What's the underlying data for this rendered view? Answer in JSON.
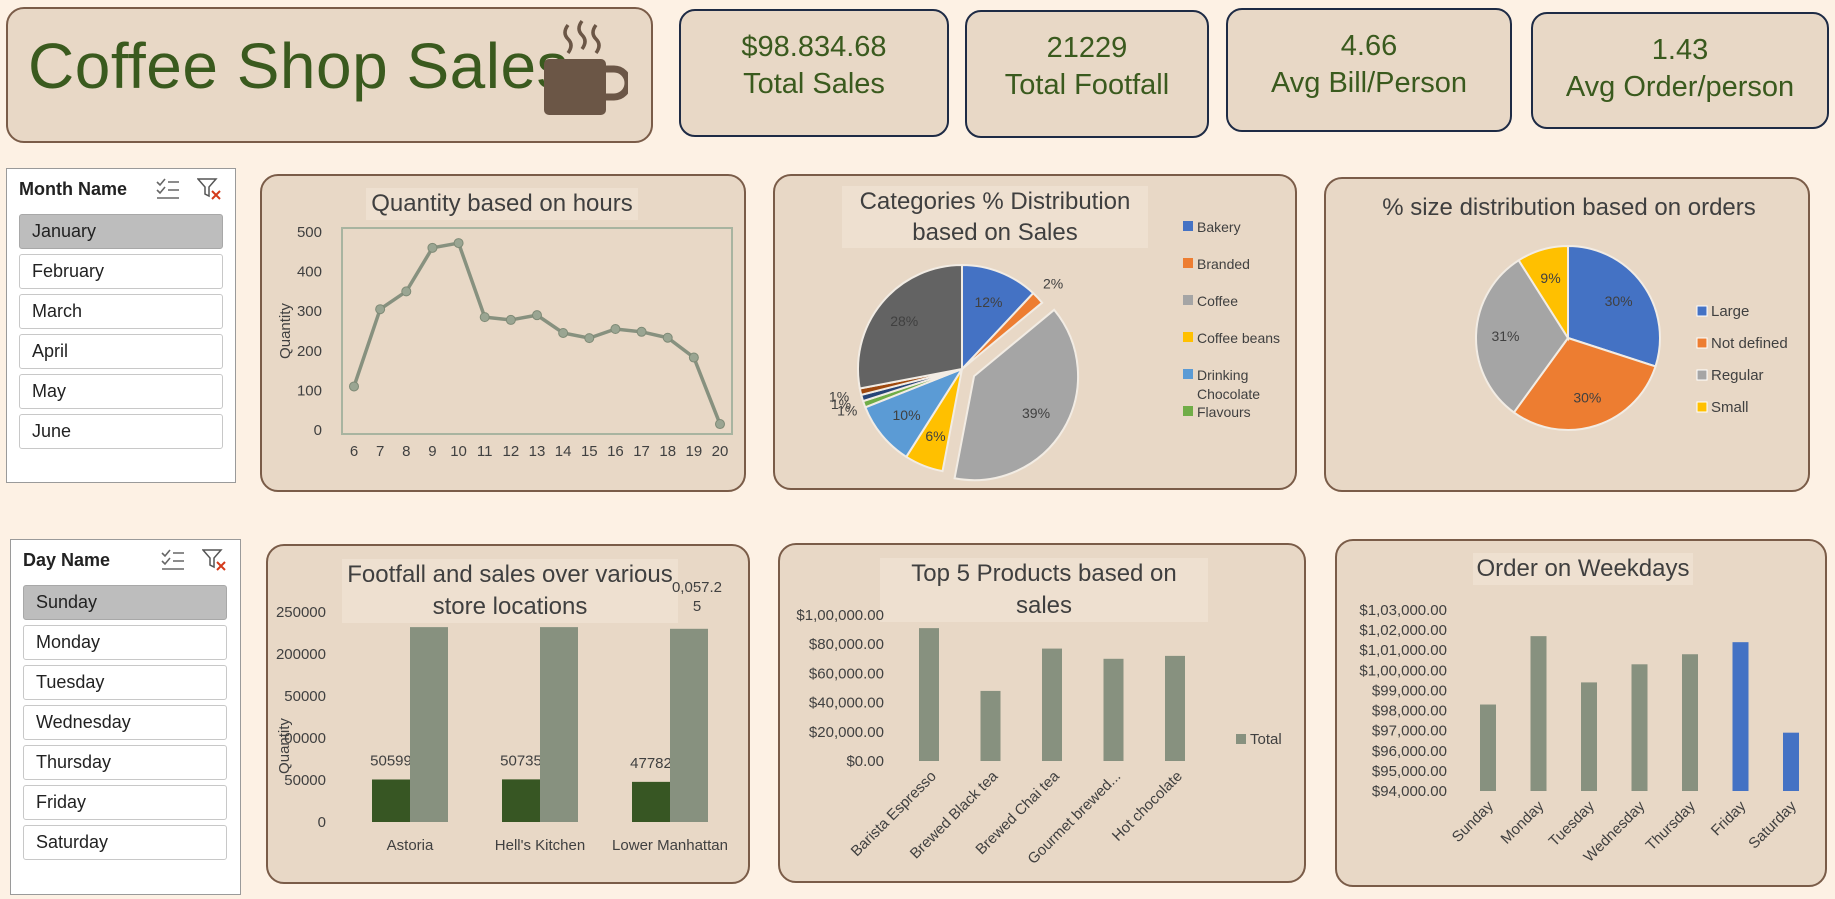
{
  "dashboard": {
    "title": "Coffee Shop Sales"
  },
  "kpis": [
    {
      "value": "$98.834.68",
      "label": "Total Sales"
    },
    {
      "value": "21229",
      "label": "Total Footfall"
    },
    {
      "value": "4.66",
      "label": "Avg Bill/Person"
    },
    {
      "value": "1.43",
      "label": "Avg Order/person"
    }
  ],
  "slicers": {
    "month": {
      "title": "Month Name",
      "items": [
        "January",
        "February",
        "March",
        "April",
        "May",
        "June"
      ],
      "selected": "January"
    },
    "day": {
      "title": "Day Name",
      "items": [
        "Sunday",
        "Monday",
        "Tuesday",
        "Wednesday",
        "Thursday",
        "Friday",
        "Saturday"
      ],
      "selected": "Sunday"
    }
  },
  "icons": [
    "coffee-cup-icon",
    "multi-select-icon",
    "clear-filter-icon"
  ],
  "colors": {
    "accent_green": "#3a5a1e",
    "series_gray": "#87917f",
    "highlight_blue": "#4472c4",
    "card_bg": "#e8d8c6",
    "page_bg": "#fdf1e4"
  },
  "chart_data": [
    {
      "id": "hours",
      "type": "line",
      "title": "Quantity based on hours",
      "ylabel": "Quantity",
      "x": [
        6,
        7,
        8,
        9,
        10,
        11,
        12,
        13,
        14,
        15,
        16,
        17,
        18,
        19,
        20
      ],
      "values": [
        110,
        305,
        350,
        460,
        472,
        285,
        278,
        290,
        245,
        232,
        255,
        248,
        233,
        183,
        15
      ],
      "ylim": [
        0,
        500
      ],
      "yticks": [
        0,
        100,
        200,
        300,
        400,
        500
      ],
      "color": "#87917f"
    },
    {
      "id": "categories",
      "type": "pie",
      "title": "Categories % Distribution based on Sales",
      "legend_position": "right",
      "slices": [
        {
          "name": "Bakery",
          "value": 12,
          "label": "12%",
          "color": "#4472c4"
        },
        {
          "name": "Branded",
          "value": 2,
          "label": "2%",
          "color": "#ed7d31"
        },
        {
          "name": "Coffee",
          "value": 39,
          "label": "39%",
          "color": "#a5a5a5"
        },
        {
          "name": "Coffee beans",
          "value": 6,
          "label": "6%",
          "color": "#ffc000"
        },
        {
          "name": "Drinking Chocolate",
          "value": 10,
          "label": "10%",
          "color": "#5b9bd5"
        },
        {
          "name": "Flavours",
          "value": 1,
          "label": "1%",
          "color": "#70ad47"
        },
        {
          "name": "",
          "value": 1,
          "label": "1%",
          "color": "#264478"
        },
        {
          "name": "",
          "value": 1,
          "label": "1%",
          "color": "#9e480e"
        },
        {
          "name": "",
          "value": 28,
          "label": "28%",
          "color": "#636363"
        }
      ]
    },
    {
      "id": "sizes",
      "type": "pie",
      "title": "% size distribution based on orders",
      "legend_position": "right",
      "slices": [
        {
          "name": "Large",
          "value": 30,
          "label": "30%",
          "color": "#4472c4"
        },
        {
          "name": "Not defined",
          "value": 30,
          "label": "30%",
          "color": "#ed7d31"
        },
        {
          "name": "Regular",
          "value": 31,
          "label": "31%",
          "color": "#a5a5a5"
        },
        {
          "name": "Small",
          "value": 9,
          "label": "9%",
          "color": "#ffc000"
        }
      ]
    },
    {
      "id": "locations",
      "type": "bar",
      "title": "Footfall and sales over various store locations",
      "ylabel": "Quantity",
      "categories": [
        "Astoria",
        "Hell's Kitchen",
        "Lower Manhattan"
      ],
      "series": [
        {
          "values": [
            50599,
            50735,
            47782
          ],
          "labels": [
            "50599",
            "50735",
            "47782"
          ],
          "color": "#375623"
        },
        {
          "values": [
            232000,
            232000,
            230000
          ],
          "labels": [
            "",
            "",
            "0,057.2\n5"
          ],
          "color": "#87917f"
        }
      ],
      "ylim": [
        0,
        250000
      ],
      "yticks": [
        "0",
        "50000",
        "00000",
        "50000",
        "200000",
        "250000"
      ]
    },
    {
      "id": "products",
      "type": "bar",
      "title": "Top 5 Products based on sales",
      "categories": [
        "Barista Espresso",
        "Brewed Black tea",
        "Brewed Chai tea",
        "Gourmet brewed...",
        "Hot chocolate"
      ],
      "series": [
        {
          "name": "Total",
          "values": [
            91000,
            48000,
            77000,
            70000,
            72000
          ],
          "color": "#87917f"
        }
      ],
      "ylim": [
        0,
        100000
      ],
      "yticks": [
        "$0.00",
        "$20,000.00",
        "$40,000.00",
        "$60,000.00",
        "$80,000.00",
        "$1,00,000.00"
      ],
      "legend_position": "right"
    },
    {
      "id": "weekdays",
      "type": "bar",
      "title": "Order on Weekdays",
      "categories": [
        "Sunday",
        "Monday",
        "Tuesday",
        "Wednesday",
        "Thursday",
        "Friday",
        "Saturday"
      ],
      "values": [
        98300,
        101700,
        99400,
        100300,
        100800,
        101400,
        96900
      ],
      "bar_colors": [
        "#87917f",
        "#87917f",
        "#87917f",
        "#87917f",
        "#87917f",
        "#4472c4",
        "#4472c4"
      ],
      "ylim": [
        94000,
        103000
      ],
      "yticks": [
        "$94,000.00",
        "$95,000.00",
        "$96,000.00",
        "$97,000.00",
        "$98,000.00",
        "$99,000.00",
        "$1,00,000.00",
        "$1,01,000.00",
        "$1,02,000.00",
        "$1,03,000.00"
      ]
    }
  ]
}
